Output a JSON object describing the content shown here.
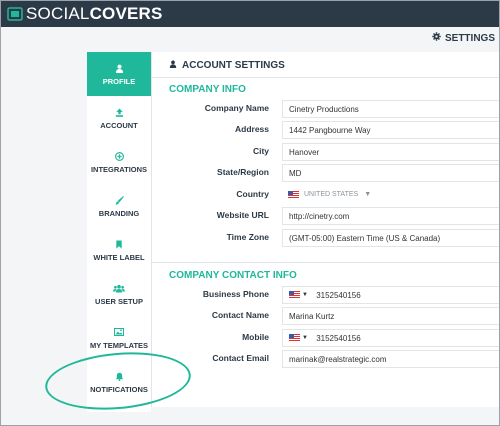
{
  "app": {
    "logo_part1": "SOCIAL",
    "logo_part2": "COVERS"
  },
  "header": {
    "settings_label": "SETTINGS"
  },
  "sidebar": {
    "items": [
      {
        "label": "PROFILE",
        "icon": "user-icon",
        "active": true
      },
      {
        "label": "ACCOUNT",
        "icon": "upload-icon",
        "active": false
      },
      {
        "label": "INTEGRATIONS",
        "icon": "plus-circle-icon",
        "active": false
      },
      {
        "label": "BRANDING",
        "icon": "brush-icon",
        "active": false
      },
      {
        "label": "WHITE LABEL",
        "icon": "bookmark-icon",
        "active": false
      },
      {
        "label": "USER SETUP",
        "icon": "users-icon",
        "active": false
      },
      {
        "label": "MY TEMPLATES",
        "icon": "image-icon",
        "active": false
      },
      {
        "label": "NOTIFICATIONS",
        "icon": "bell-icon",
        "active": false
      }
    ]
  },
  "panel": {
    "title": "ACCOUNT SETTINGS",
    "company_info": {
      "title": "COMPANY INFO",
      "fields": [
        {
          "label": "Company Name",
          "value": "Cinetry Productions"
        },
        {
          "label": "Address",
          "value": "1442 Pangbourne Way"
        },
        {
          "label": "City",
          "value": "Hanover"
        },
        {
          "label": "State/Region",
          "value": "MD"
        },
        {
          "label": "Country",
          "value": "UNITED STATES"
        },
        {
          "label": "Website URL",
          "value": "http://cinetry.com"
        },
        {
          "label": "Time Zone",
          "value": "(GMT-05:00) Eastern Time (US & Canada)"
        }
      ]
    },
    "contact_info": {
      "title": "COMPANY CONTACT INFO",
      "fields": [
        {
          "label": "Business Phone",
          "value": "3152540156"
        },
        {
          "label": "Contact Name",
          "value": "Marina Kurtz"
        },
        {
          "label": "Mobile",
          "value": "3152540156"
        },
        {
          "label": "Contact Email",
          "value": "marinak@realstrategic.com"
        }
      ]
    }
  },
  "colors": {
    "accent": "#1fb89a",
    "topbar": "#2c3a47",
    "text": "#2c3a47"
  }
}
